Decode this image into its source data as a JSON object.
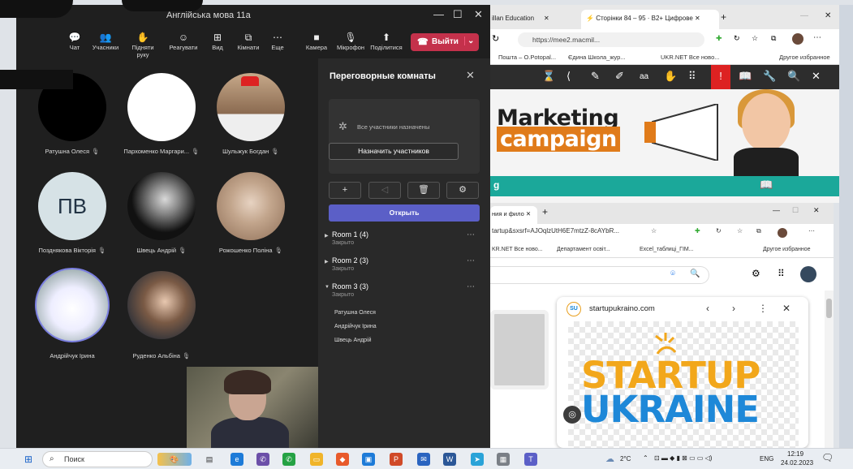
{
  "teams": {
    "title": "Англійська мова 11а",
    "window_controls": [
      "—",
      "☐",
      "✕"
    ],
    "toolbar": [
      {
        "label": "Чат",
        "icon": "chat-icon"
      },
      {
        "label": "Учасники",
        "icon": "people-icon"
      },
      {
        "label": "Підняти руку",
        "icon": "hand-icon"
      },
      {
        "label": "Реагувати",
        "icon": "smile-icon"
      },
      {
        "label": "Вид",
        "icon": "grid-icon"
      },
      {
        "label": "Кімнати",
        "icon": "rooms-icon"
      },
      {
        "label": "Еще",
        "icon": "more-icon"
      },
      {
        "label": "Камера",
        "icon": "camera-icon"
      },
      {
        "label": "Мікрофон",
        "icon": "mic-icon"
      },
      {
        "label": "Поділитися",
        "icon": "share-icon"
      }
    ],
    "leave_label": "Выйти",
    "participants": [
      {
        "name": "Ратушна Олеся"
      },
      {
        "name": "Пархоменко Маргари..."
      },
      {
        "name": "Шульжук Богдан"
      },
      {
        "name": "Позднякова Вікторія",
        "initials": "ПВ"
      },
      {
        "name": "Швець Андрій"
      },
      {
        "name": "Рожошенко Поліна"
      },
      {
        "name": "Андрійчук Ірина"
      },
      {
        "name": "Руденко Альбіна"
      }
    ],
    "breakout": {
      "title": "Переговорные комнаты",
      "status": "Все участники назначены",
      "assign_label": "Назначить участников",
      "open_label": "Открыть",
      "rooms": [
        {
          "name": "Room 1 (4)",
          "state": "Закрыто"
        },
        {
          "name": "Room 2 (3)",
          "state": "Закрыто"
        },
        {
          "name": "Room 3 (3)",
          "state": "Закрыто",
          "members": [
            "Ратушна Олеся",
            "Андрійчук Ірина",
            "Швець Андрій"
          ]
        }
      ]
    }
  },
  "browser1": {
    "tabs": [
      "illan Education",
      "Сторінки 84 – 95 · B2+ Цифрове"
    ],
    "url": "https://mee2.macmil...",
    "favorites": [
      "Пошта – O.Potopal...",
      "Єдина Школа_жур...",
      "UKR.NET Все ново...",
      "Другое избранное"
    ],
    "book_text": {
      "line1": "Marketing",
      "line2": "campaign",
      "band": "g"
    }
  },
  "browser2": {
    "tab": "ния и фило",
    "url": "tartup&sxsrf=AJOqlzUtH6E7mtzZ-8cAYbR...",
    "favorites": [
      "KR.NET Все ново...",
      "Департамент освіт...",
      "Excel_таблиці_ГІМ...",
      "Другое избранное"
    ],
    "popup_site": "startupukraino.com",
    "logo": {
      "line1": "STARTUP",
      "line2": "UKRAINE"
    }
  },
  "taskbar": {
    "search_label": "Поиск",
    "weather": "2°C",
    "lang": "ENG",
    "time": "12:19",
    "date": "24.02.2023"
  }
}
